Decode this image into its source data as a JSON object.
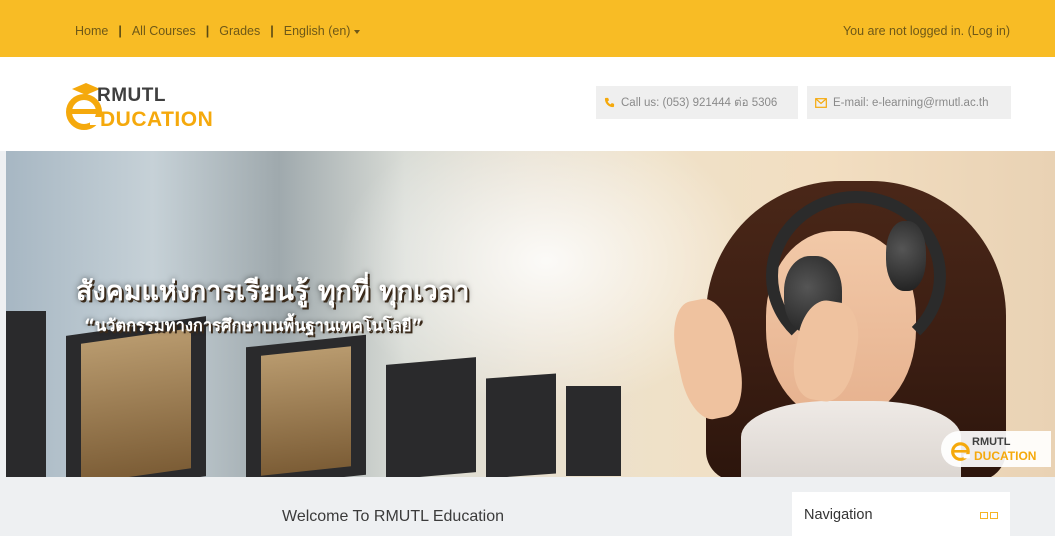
{
  "topbar": {
    "nav": [
      {
        "label": "Home"
      },
      {
        "label": "All Courses"
      },
      {
        "label": "Grades"
      },
      {
        "label": "English (en)"
      }
    ],
    "separator": "|",
    "login_text": "You are not logged in.",
    "login_link": "(Log in)"
  },
  "header": {
    "logo_top": "RMUTL",
    "logo_bottom": "DUCATION",
    "phone": "Call us: (053) 921444 ต่อ 5306",
    "email": "E-mail: e-learning@rmutl.ac.th"
  },
  "banner": {
    "headline": "สังคมแห่งการเรียนรู้ ทุกที่ ทุกเวลา",
    "subline": "“นวัตกรรมทางการศึกษาบนพื้นฐานเทคโนโลยี”",
    "watermark_top": "RMUTL",
    "watermark_bottom": "DUCATION"
  },
  "main": {
    "welcome": "Welcome To RMUTL Education"
  },
  "navigation_block": {
    "title": "Navigation"
  },
  "colors": {
    "topbar": "#f8bc25",
    "accent": "#f5a90c"
  }
}
